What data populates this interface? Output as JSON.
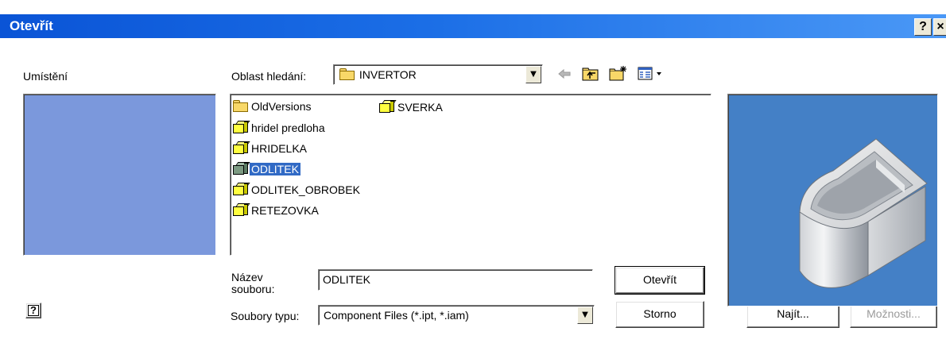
{
  "window": {
    "title": "Otevřít",
    "help_button": "?",
    "close_button": "×"
  },
  "places": {
    "label": "Umístění"
  },
  "look_in": {
    "label": "Oblast hledání:",
    "value": "INVERTOR"
  },
  "files": {
    "column1": [
      {
        "name": "OldVersions",
        "type": "folder",
        "selected": false
      },
      {
        "name": "hridel predloha",
        "type": "part",
        "selected": false
      },
      {
        "name": "HRIDELKA",
        "type": "part",
        "selected": false
      },
      {
        "name": "ODLITEK",
        "type": "part",
        "selected": true
      },
      {
        "name": "ODLITEK_OBROBEK",
        "type": "part",
        "selected": false
      },
      {
        "name": "RETEZOVKA",
        "type": "part",
        "selected": false
      }
    ],
    "column2": [
      {
        "name": "SVERKA",
        "type": "part",
        "selected": false
      }
    ]
  },
  "filename": {
    "label": "Název souboru:",
    "value": "ODLITEK"
  },
  "filetype": {
    "label": "Soubory typu:",
    "value": "Component Files (*.ipt, *.iam)"
  },
  "buttons": {
    "open": "Otevřít",
    "cancel": "Storno",
    "find": "Najít...",
    "options": "Možnosti...",
    "help_icon": "?"
  },
  "colors": {
    "titlebar": "#0a54d6",
    "places_bg": "#7b98dc",
    "selection": "#316ac5",
    "preview_bg": "#4480c6"
  }
}
